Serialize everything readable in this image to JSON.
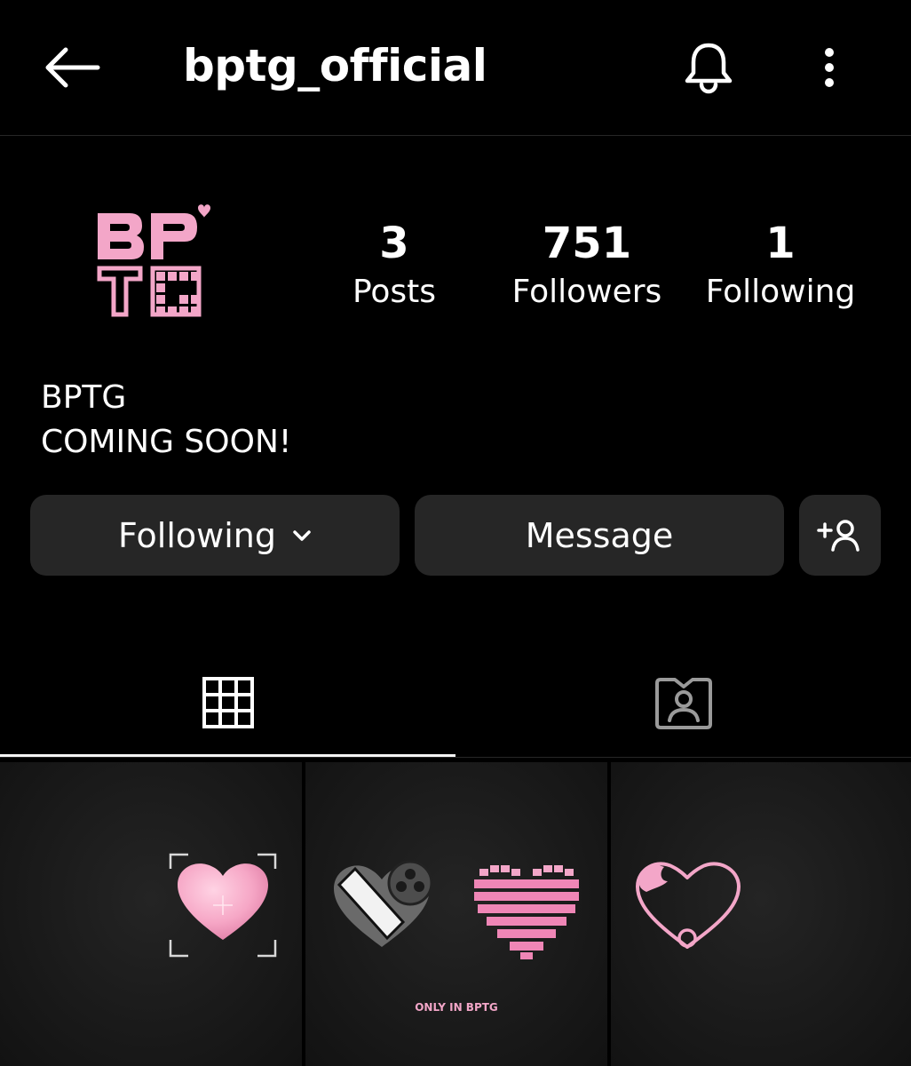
{
  "header": {
    "username": "bptg_official",
    "back_icon": "arrow-left-icon",
    "bell_icon": "bell-icon",
    "more_icon": "more-vertical-icon"
  },
  "profile": {
    "avatar_text": "BPTG",
    "stats": {
      "posts": {
        "value": "3",
        "label": "Posts"
      },
      "followers": {
        "value": "751",
        "label": "Followers"
      },
      "following": {
        "value": "1",
        "label": "Following"
      }
    },
    "bio_name": "BPTG",
    "bio_text": "COMING SOON!"
  },
  "actions": {
    "following_label": "Following",
    "message_label": "Message",
    "add_person_icon": "add-person-icon"
  },
  "tabs": [
    {
      "icon": "grid-icon",
      "active": true
    },
    {
      "icon": "tagged-person-icon",
      "active": false
    }
  ],
  "posts": [
    {
      "icon": "heart-focus-icon",
      "caption": ""
    },
    {
      "icon": "film-heart-icon",
      "caption": "ONLY IN BPTG"
    },
    {
      "icon": "outline-heart-icon",
      "caption": ""
    }
  ],
  "colors": {
    "background": "#000000",
    "button_bg": "#262626",
    "brand_pink": "#f3a6c8",
    "text": "#ffffff"
  }
}
